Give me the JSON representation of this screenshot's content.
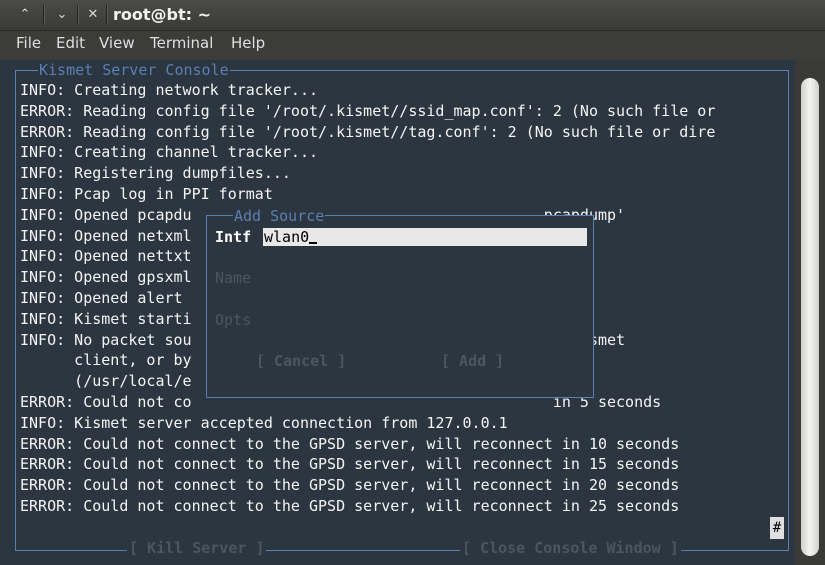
{
  "window": {
    "title": "root@bt: ~"
  },
  "menubar": [
    "File",
    "Edit",
    "View",
    "Terminal",
    "Help"
  ],
  "console": {
    "title": "Kismet Server Console",
    "lines": [
      "INFO: Creating network tracker...",
      "ERROR: Reading config file '/root/.kismet//ssid_map.conf': 2 (No such file or",
      "ERROR: Reading config file '/root/.kismet//tag.conf': 2 (No such file or dire",
      "INFO: Creating channel tracker...",
      "INFO: Registering dumpfiles...",
      "INFO: Pcap log in PPI format",
      "INFO: Opened pcapdu                                       pcapdump'",
      "INFO: Opened netxml                                       txml'",
      "INFO: Opened nettxt                                       ttxt'",
      "INFO: Opened gpsxml                                       sxml'",
      "INFO: Opened alert                                        rt'",
      "INFO: Kismet starti",
      "INFO: No packet sou                                       he Kismet",
      "      client, or by",
      "      (/usr/local/e",
      "ERROR: Could not co                                        in 5 seconds",
      "INFO: Kismet server accepted connection from 127.0.0.1",
      "ERROR: Could not connect to the GPSD server, will reconnect in 10 seconds",
      "ERROR: Could not connect to the GPSD server, will reconnect in 15 seconds",
      "ERROR: Could not connect to the GPSD server, will reconnect in 20 seconds",
      "ERROR: Could not connect to the GPSD server, will reconnect in 25 seconds"
    ],
    "kill_button": "[ Kill Server ]",
    "close_button": "[ Close Console Window ]",
    "hash_glyph": "#"
  },
  "dialog": {
    "title": "Add Source",
    "intf_label": "Intf",
    "intf_value": "wlan0",
    "name_label": "Name",
    "opts_label": "Opts",
    "cancel": "[ Cancel ]",
    "add": "[ Add ]"
  }
}
